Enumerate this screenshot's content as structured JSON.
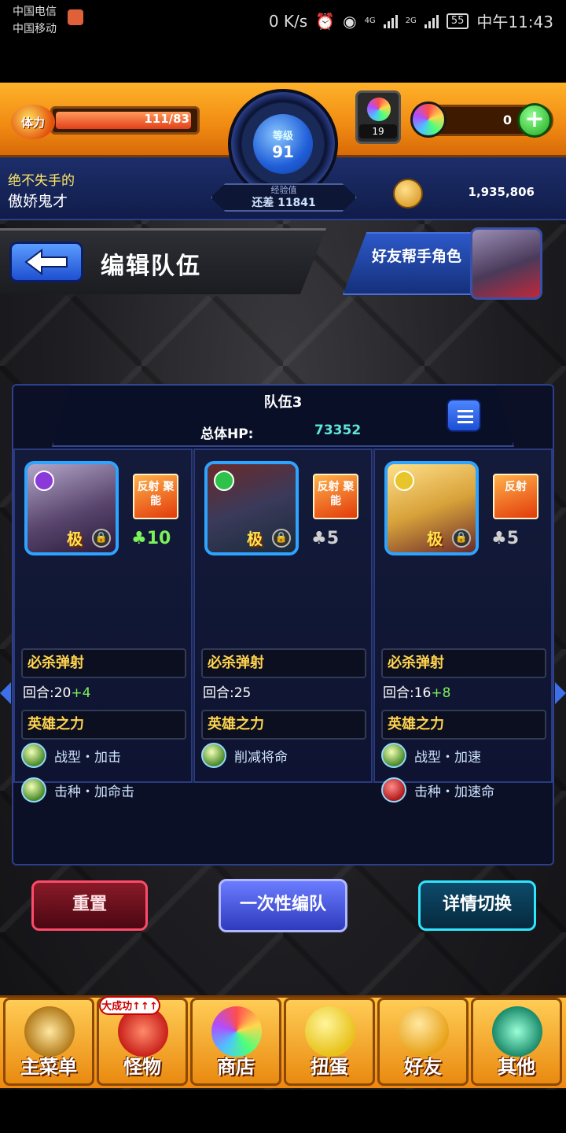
{
  "status_bar": {
    "carrier1": "中国电信",
    "carrier2": "中国移动",
    "net_speed": "0 K/s",
    "net1": "4G",
    "net2": "2G",
    "battery": "55",
    "time": "中午11:43"
  },
  "hud": {
    "stamina_label": "体力",
    "stamina_text": "111/83",
    "level_label": "等级",
    "level_value": "91",
    "exp_title": "经验值",
    "exp_text": "还差 11841",
    "gem_count": "19",
    "orb_count": "0",
    "title_line1": "绝不失手的",
    "title_line2": "傲娇鬼才",
    "coin_value": "1,935,806"
  },
  "header": {
    "page_title": "编辑队伍",
    "helper_label": "好友帮手角色"
  },
  "team": {
    "name": "队伍3",
    "hp_label": "总体HP:",
    "hp_value": "73352",
    "members": [
      {
        "ability": "反射 聚能",
        "luck": "♣10",
        "rank": "极",
        "skill_label": "必杀弹射",
        "turns": "回合:20",
        "turns_plus": "+4",
        "power_label": "英雄之力",
        "powers": [
          "战型・加击",
          "击种・加命击"
        ]
      },
      {
        "ability": "反射 聚能",
        "luck": "♣5",
        "rank": "极",
        "skill_label": "必杀弹射",
        "turns": "回合:25",
        "turns_plus": "",
        "power_label": "英雄之力",
        "powers": [
          "削减将命"
        ]
      },
      {
        "ability": "反射",
        "luck": "♣5",
        "rank": "极",
        "skill_label": "必杀弹射",
        "turns": "回合:16",
        "turns_plus": "+8",
        "power_label": "英雄之力",
        "powers": [
          "战型・加速",
          "击种・加速命"
        ]
      }
    ]
  },
  "actions": {
    "reset": "重置",
    "once": "一次性编队",
    "detail": "详情切换"
  },
  "nav": {
    "badge": "大成功↑↑↑",
    "items": [
      "主菜单",
      "怪物",
      "商店",
      "扭蛋",
      "好友",
      "其他"
    ]
  },
  "colors": {
    "accent_orange": "#f08a12",
    "navy": "#101c4a",
    "hp_teal": "#5fe6d8"
  }
}
